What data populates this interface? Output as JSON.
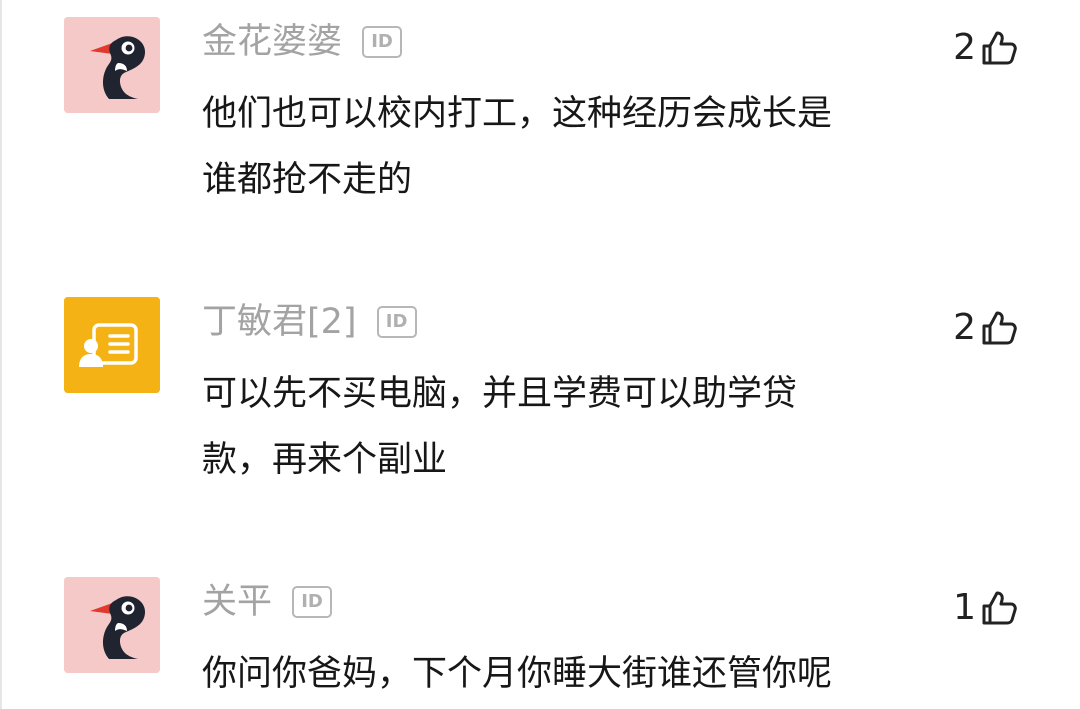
{
  "comments": [
    {
      "username": "金花婆婆",
      "id_badge": "ID",
      "likes": "2",
      "text": "他们也可以校内打工，这种经历会成长是\n谁都抢不走的",
      "avatar_icon": "woodpecker-icon",
      "avatar_bg": "#f5c9c8"
    },
    {
      "username": "丁敏君[2]",
      "id_badge": "ID",
      "likes": "2",
      "text": "可以先不买电脑，并且学费可以助学贷\n款，再来个副业",
      "avatar_icon": "id-card-icon",
      "avatar_bg": "#f5b214"
    },
    {
      "username": "关平",
      "id_badge": "ID",
      "likes": "1",
      "text": "你问你爸妈，下个月你睡大街谁还管你呢",
      "avatar_icon": "woodpecker-icon",
      "avatar_bg": "#f5c9c8"
    }
  ],
  "colors": {
    "username": "#a3a3a3",
    "text": "#171717",
    "badge_border": "#b7b7b7"
  }
}
